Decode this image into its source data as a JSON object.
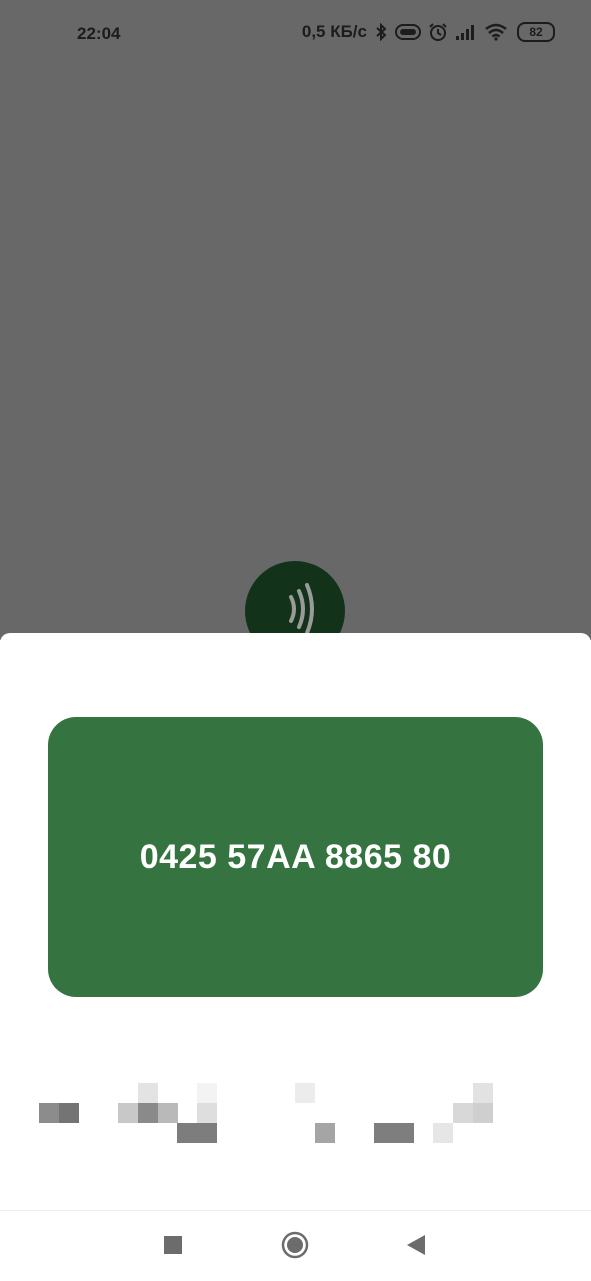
{
  "status_bar": {
    "time": "22:04",
    "net_speed": "0,5 КБ/с",
    "icons": [
      "bluetooth-icon",
      "vibrate-icon",
      "alarm-icon",
      "signal-icon",
      "wifi-icon"
    ],
    "battery": "82"
  },
  "nfc_badge": {
    "icon": "nfc-icon"
  },
  "card": {
    "number": "0425 57AA 8865 80",
    "color": "#357440"
  },
  "obscured_text": {
    "note_visible": false
  },
  "navbar": {
    "recents_icon": "square-icon",
    "home_icon": "circle-icon",
    "back_icon": "triangle-back-icon"
  }
}
